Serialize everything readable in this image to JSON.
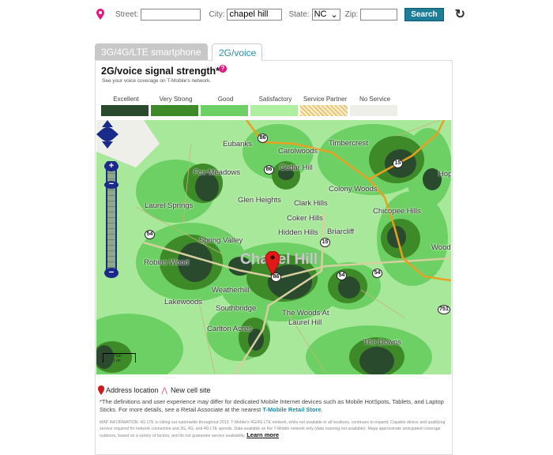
{
  "search": {
    "street_label": "Street:",
    "street_value": "",
    "city_label": "City:",
    "city_value": "chapel hill",
    "state_label": "State:",
    "state_value": "NC",
    "zip_label": "Zip:",
    "zip_value": "",
    "search_button": "Search"
  },
  "tabs": [
    {
      "label": "3G/4G/LTE smartphone",
      "active": false
    },
    {
      "label": "2G/voice",
      "active": true
    }
  ],
  "panel": {
    "title": "2G/voice signal strength*",
    "help": "?",
    "subtitle": "See your voice coverage on T-Mobile's network."
  },
  "legend": [
    {
      "label": "Excellent",
      "color": "#2a4a2e"
    },
    {
      "label": "Very Strong",
      "color": "#3e8a28"
    },
    {
      "label": "Good",
      "color": "#6dd064"
    },
    {
      "label": "Satisfactory",
      "color": "#aef0a0"
    },
    {
      "label": "Service Partner",
      "color": "#f2dca0"
    },
    {
      "label": "No Service",
      "color": "#efefea"
    }
  ],
  "map": {
    "city": "Chapel Hill",
    "places": [
      "Eubanks",
      "Carolwoods",
      "Timbercrest",
      "Cedar Hill",
      "Fox Meadows",
      "Colony Woods",
      "Glen Heights",
      "Clark Hills",
      "Laurel Springs",
      "Chicopee Hills",
      "Coker Hills",
      "Hidden Hills",
      "Briarcliff",
      "Spring Valley",
      "Robins Wood",
      "Weatherhill",
      "Lakewoods",
      "Southbridge",
      "The Woods At",
      "Laurel Hill",
      "Carlton Acres",
      "The Downs",
      "Wood",
      "Hop"
    ],
    "shields": [
      "86",
      "86",
      "15",
      "54",
      "15",
      "86",
      "54",
      "54",
      "751"
    ],
    "scale_km": "2 km",
    "scale_mi": "1 mi"
  },
  "footer": {
    "address_location": "Address location",
    "new_cell_site": "New cell site",
    "disclaimer": "*The definitions and user experience may differ for dedicated Mobile Internet devices such as Mobile HotSpots, Tablets, and Laptop Sticks. For more details, see a Retail Associate at the nearest ",
    "store_link": "T-Mobile Retail Store",
    "map_info": "MAP INFORMATION: 4G LTE is rolling out nationwide throughout 2013. T-Mobile's 4G/4G LTE network, while not available in all locations, continues to expand. Capable device and qualifying service required for network connection and 3G, 4G, and 4G LTE speeds. Data available on the T-Mobile network only (data roaming not available). Maps approximate anticipated coverage outdoors, based on a variety of factors, and do not guarantee service availability. ",
    "learn_more": "Learn more"
  }
}
